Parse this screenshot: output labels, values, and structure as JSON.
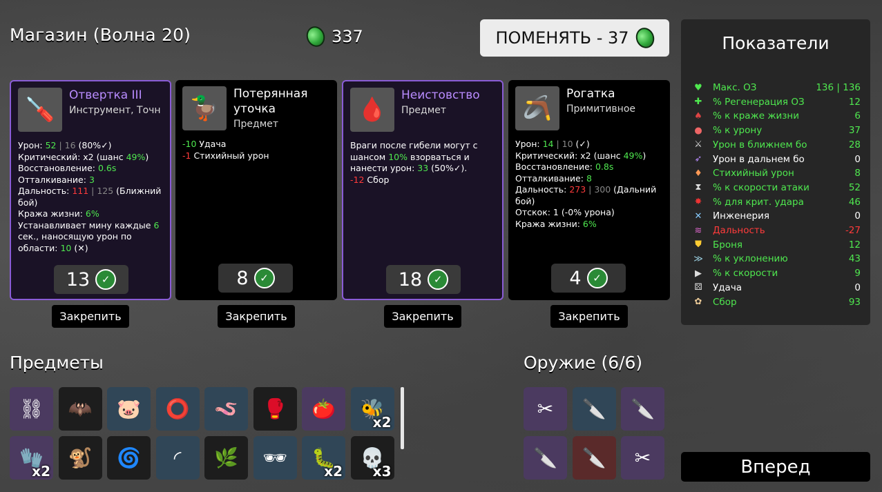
{
  "header": {
    "title": "Магазин (Волна 20)",
    "money": "337",
    "reroll_label": "ПОМЕНЯТЬ - 37"
  },
  "shop": [
    {
      "name": "Отвертка III",
      "sub": "Инструмент, Точн",
      "icon": "🪛",
      "price": "13",
      "lines": [
        {
          "parts": [
            [
              "Урон: ",
              ""
            ],
            [
              "52",
              "g"
            ],
            [
              " | ",
              "dim"
            ],
            [
              "16",
              "dim"
            ],
            [
              " (80%",
              ""
            ],
            [
              "✓",
              ""
            ],
            [
              ")",
              ""
            ]
          ]
        },
        {
          "parts": [
            [
              "Критический: x2 (шанс ",
              ""
            ],
            [
              "49%",
              "g"
            ],
            [
              ")",
              ""
            ]
          ]
        },
        {
          "parts": [
            [
              "Восстановление: ",
              ""
            ],
            [
              "0.6s",
              "g"
            ]
          ]
        },
        {
          "parts": [
            [
              "Отталкивание: ",
              ""
            ],
            [
              "3",
              "g"
            ]
          ]
        },
        {
          "parts": [
            [
              "Дальность: ",
              ""
            ],
            [
              "111",
              "r"
            ],
            [
              " | ",
              "dim"
            ],
            [
              "125",
              "dim"
            ],
            [
              " (Ближний бой)",
              ""
            ]
          ]
        },
        {
          "parts": [
            [
              "Кража жизни: ",
              ""
            ],
            [
              "6%",
              "g"
            ]
          ]
        },
        {
          "parts": [
            [
              "Устанавливает мину каждые ",
              ""
            ],
            [
              "6",
              "g"
            ],
            [
              " сек., наносящую урон по области: ",
              ""
            ],
            [
              "10",
              "g"
            ],
            [
              " (",
              ""
            ],
            [
              "✕",
              ""
            ],
            [
              ")",
              ""
            ]
          ]
        }
      ]
    },
    {
      "name": "Потерянная уточка",
      "sub": "Предмет",
      "icon": "🦆",
      "price": "8",
      "lines": [
        {
          "parts": [
            [
              "-10",
              "g"
            ],
            [
              " Удача",
              ""
            ]
          ]
        },
        {
          "parts": [
            [
              "-1",
              "r"
            ],
            [
              " Стихийный урон",
              ""
            ]
          ]
        }
      ]
    },
    {
      "name": "Неистовство",
      "sub": "Предмет",
      "icon": "🩸",
      "price": "18",
      "lines": [
        {
          "parts": [
            [
              "Враги после гибели могут с шансом ",
              ""
            ],
            [
              "10%",
              "g"
            ],
            [
              " взорваться и нанести урон: ",
              ""
            ],
            [
              "33",
              "g"
            ],
            [
              " (50%",
              ""
            ],
            [
              "✓",
              ""
            ],
            [
              ").",
              ""
            ]
          ]
        },
        {
          "parts": [
            [
              "-12",
              "r"
            ],
            [
              " Сбор",
              ""
            ]
          ]
        }
      ]
    },
    {
      "name": "Рогатка",
      "sub": "Примитивное",
      "icon": "🪃",
      "price": "4",
      "lines": [
        {
          "parts": [
            [
              "Урон: ",
              ""
            ],
            [
              "14",
              "g"
            ],
            [
              " | ",
              "dim"
            ],
            [
              "10",
              "dim"
            ],
            [
              " (",
              ""
            ],
            [
              "✓",
              ""
            ],
            [
              ")",
              ""
            ]
          ]
        },
        {
          "parts": [
            [
              "Критический: x2 (шанс ",
              ""
            ],
            [
              "49%",
              "g"
            ],
            [
              ")",
              ""
            ]
          ]
        },
        {
          "parts": [
            [
              "Восстановление: ",
              ""
            ],
            [
              "0.8s",
              "g"
            ]
          ]
        },
        {
          "parts": [
            [
              "Отталкивание: ",
              ""
            ],
            [
              "8",
              "g"
            ]
          ]
        },
        {
          "parts": [
            [
              "Дальность: ",
              ""
            ],
            [
              "273",
              "r"
            ],
            [
              " | ",
              "dim"
            ],
            [
              "300",
              "dim"
            ],
            [
              " (Дальний бой)",
              ""
            ]
          ]
        },
        {
          "parts": [
            [
              "Отскок: 1 (-0% урона)",
              ""
            ]
          ]
        },
        {
          "parts": [
            [
              "Кража жизни: ",
              ""
            ],
            [
              "6%",
              "g"
            ]
          ]
        }
      ]
    }
  ],
  "lock_label": "Закрепить",
  "stats": {
    "title": "Показатели",
    "rows": [
      {
        "icon": "♥",
        "label": "Макс. ОЗ",
        "value": "136 | 136",
        "color": "#4fe84f",
        "icolor": "#4fe84f"
      },
      {
        "icon": "✚",
        "label": "% Регенерация ОЗ",
        "value": "12",
        "color": "#4fe84f",
        "icolor": "#4fe84f"
      },
      {
        "icon": "♠",
        "label": "% к краже жизни",
        "value": "6",
        "color": "#4fe84f",
        "icolor": "#d44"
      },
      {
        "icon": "●",
        "label": "% к урону",
        "value": "37",
        "color": "#4fe84f",
        "icolor": "#e66"
      },
      {
        "icon": "⚔",
        "label": "Урон в ближнем бо",
        "value": "28",
        "color": "#4fe84f",
        "icolor": "#ddd"
      },
      {
        "icon": "➶",
        "label": "Урон в дальнем бо",
        "value": "0",
        "color": "#ffffff",
        "icolor": "#b98cff"
      },
      {
        "icon": "♦",
        "label": "Стихийный урон",
        "value": "8",
        "color": "#4fe84f",
        "icolor": "#f95"
      },
      {
        "icon": "⧗",
        "label": "% к скорости атаки",
        "value": "52",
        "color": "#4fe84f",
        "icolor": "#ddd"
      },
      {
        "icon": "✸",
        "label": "% для крит. удара",
        "value": "46",
        "color": "#4fe84f",
        "icolor": "#e33"
      },
      {
        "icon": "✕",
        "label": "Инженерия",
        "value": "0",
        "color": "#ffffff",
        "icolor": "#8cf"
      },
      {
        "icon": "≋",
        "label": "Дальность",
        "value": "-27",
        "color": "#ff3b3b",
        "icolor": "#d6c"
      },
      {
        "icon": "⛊",
        "label": "Броня",
        "value": "12",
        "color": "#4fe84f",
        "icolor": "#fc3"
      },
      {
        "icon": "≫",
        "label": "% к уклонению",
        "value": "43",
        "color": "#4fe84f",
        "icolor": "#9cd"
      },
      {
        "icon": "▶",
        "label": "% к скорости",
        "value": "9",
        "color": "#4fe84f",
        "icolor": "#ddd"
      },
      {
        "icon": "⚄",
        "label": "Удача",
        "value": "0",
        "color": "#ffffff",
        "icolor": "#ddd"
      },
      {
        "icon": "✿",
        "label": "Сбор",
        "value": "93",
        "color": "#4fe84f",
        "icolor": "#ec9"
      }
    ]
  },
  "items_title": "Предметы",
  "weapons_title": "Оружие (6/6)",
  "items": [
    {
      "icon": "⛓",
      "tier": "p",
      "name": "handcuffs-icon"
    },
    {
      "icon": "🦇",
      "tier": "k",
      "name": "bat-icon"
    },
    {
      "icon": "🐷",
      "tier": "b",
      "name": "piggy-bank-icon"
    },
    {
      "icon": "⭕",
      "tier": "b",
      "name": "ring-icon"
    },
    {
      "icon": "🪱",
      "tier": "b",
      "name": "worm-icon"
    },
    {
      "icon": "🥊",
      "tier": "k",
      "name": "boxing-glove-icon"
    },
    {
      "icon": "🍅",
      "tier": "p",
      "name": "tomato-icon"
    },
    {
      "icon": "🐝",
      "tier": "b",
      "name": "bee-icon",
      "count": "x2"
    },
    {
      "icon": "🧤",
      "tier": "p",
      "name": "gauntlet-icon",
      "count": "x2"
    },
    {
      "icon": "🐒",
      "tier": "k",
      "name": "monkey-icon"
    },
    {
      "icon": "🌀",
      "tier": "k",
      "name": "swirl-icon"
    },
    {
      "icon": "◜",
      "tier": "b",
      "name": "blade-icon"
    },
    {
      "icon": "🌿",
      "tier": "k",
      "name": "plant-sack-icon"
    },
    {
      "icon": "🕶",
      "tier": "b",
      "name": "glasses-icon"
    },
    {
      "icon": "🐛",
      "tier": "b",
      "name": "larva-icon",
      "count": "x2"
    },
    {
      "icon": "💀",
      "tier": "k",
      "name": "skull-icon",
      "count": "x3"
    }
  ],
  "weapons": [
    {
      "icon": "✂",
      "tier": "p",
      "name": "scissors-icon"
    },
    {
      "icon": "🔪",
      "tier": "b",
      "name": "knife-icon"
    },
    {
      "icon": "🔪",
      "tier": "p",
      "name": "knife-icon"
    },
    {
      "icon": "🔪",
      "tier": "p",
      "name": "knife-icon"
    },
    {
      "icon": "🔪",
      "tier": "r",
      "name": "knife-icon"
    },
    {
      "icon": "✂",
      "tier": "p",
      "name": "scissors-icon"
    }
  ],
  "go_label": "Вперед"
}
